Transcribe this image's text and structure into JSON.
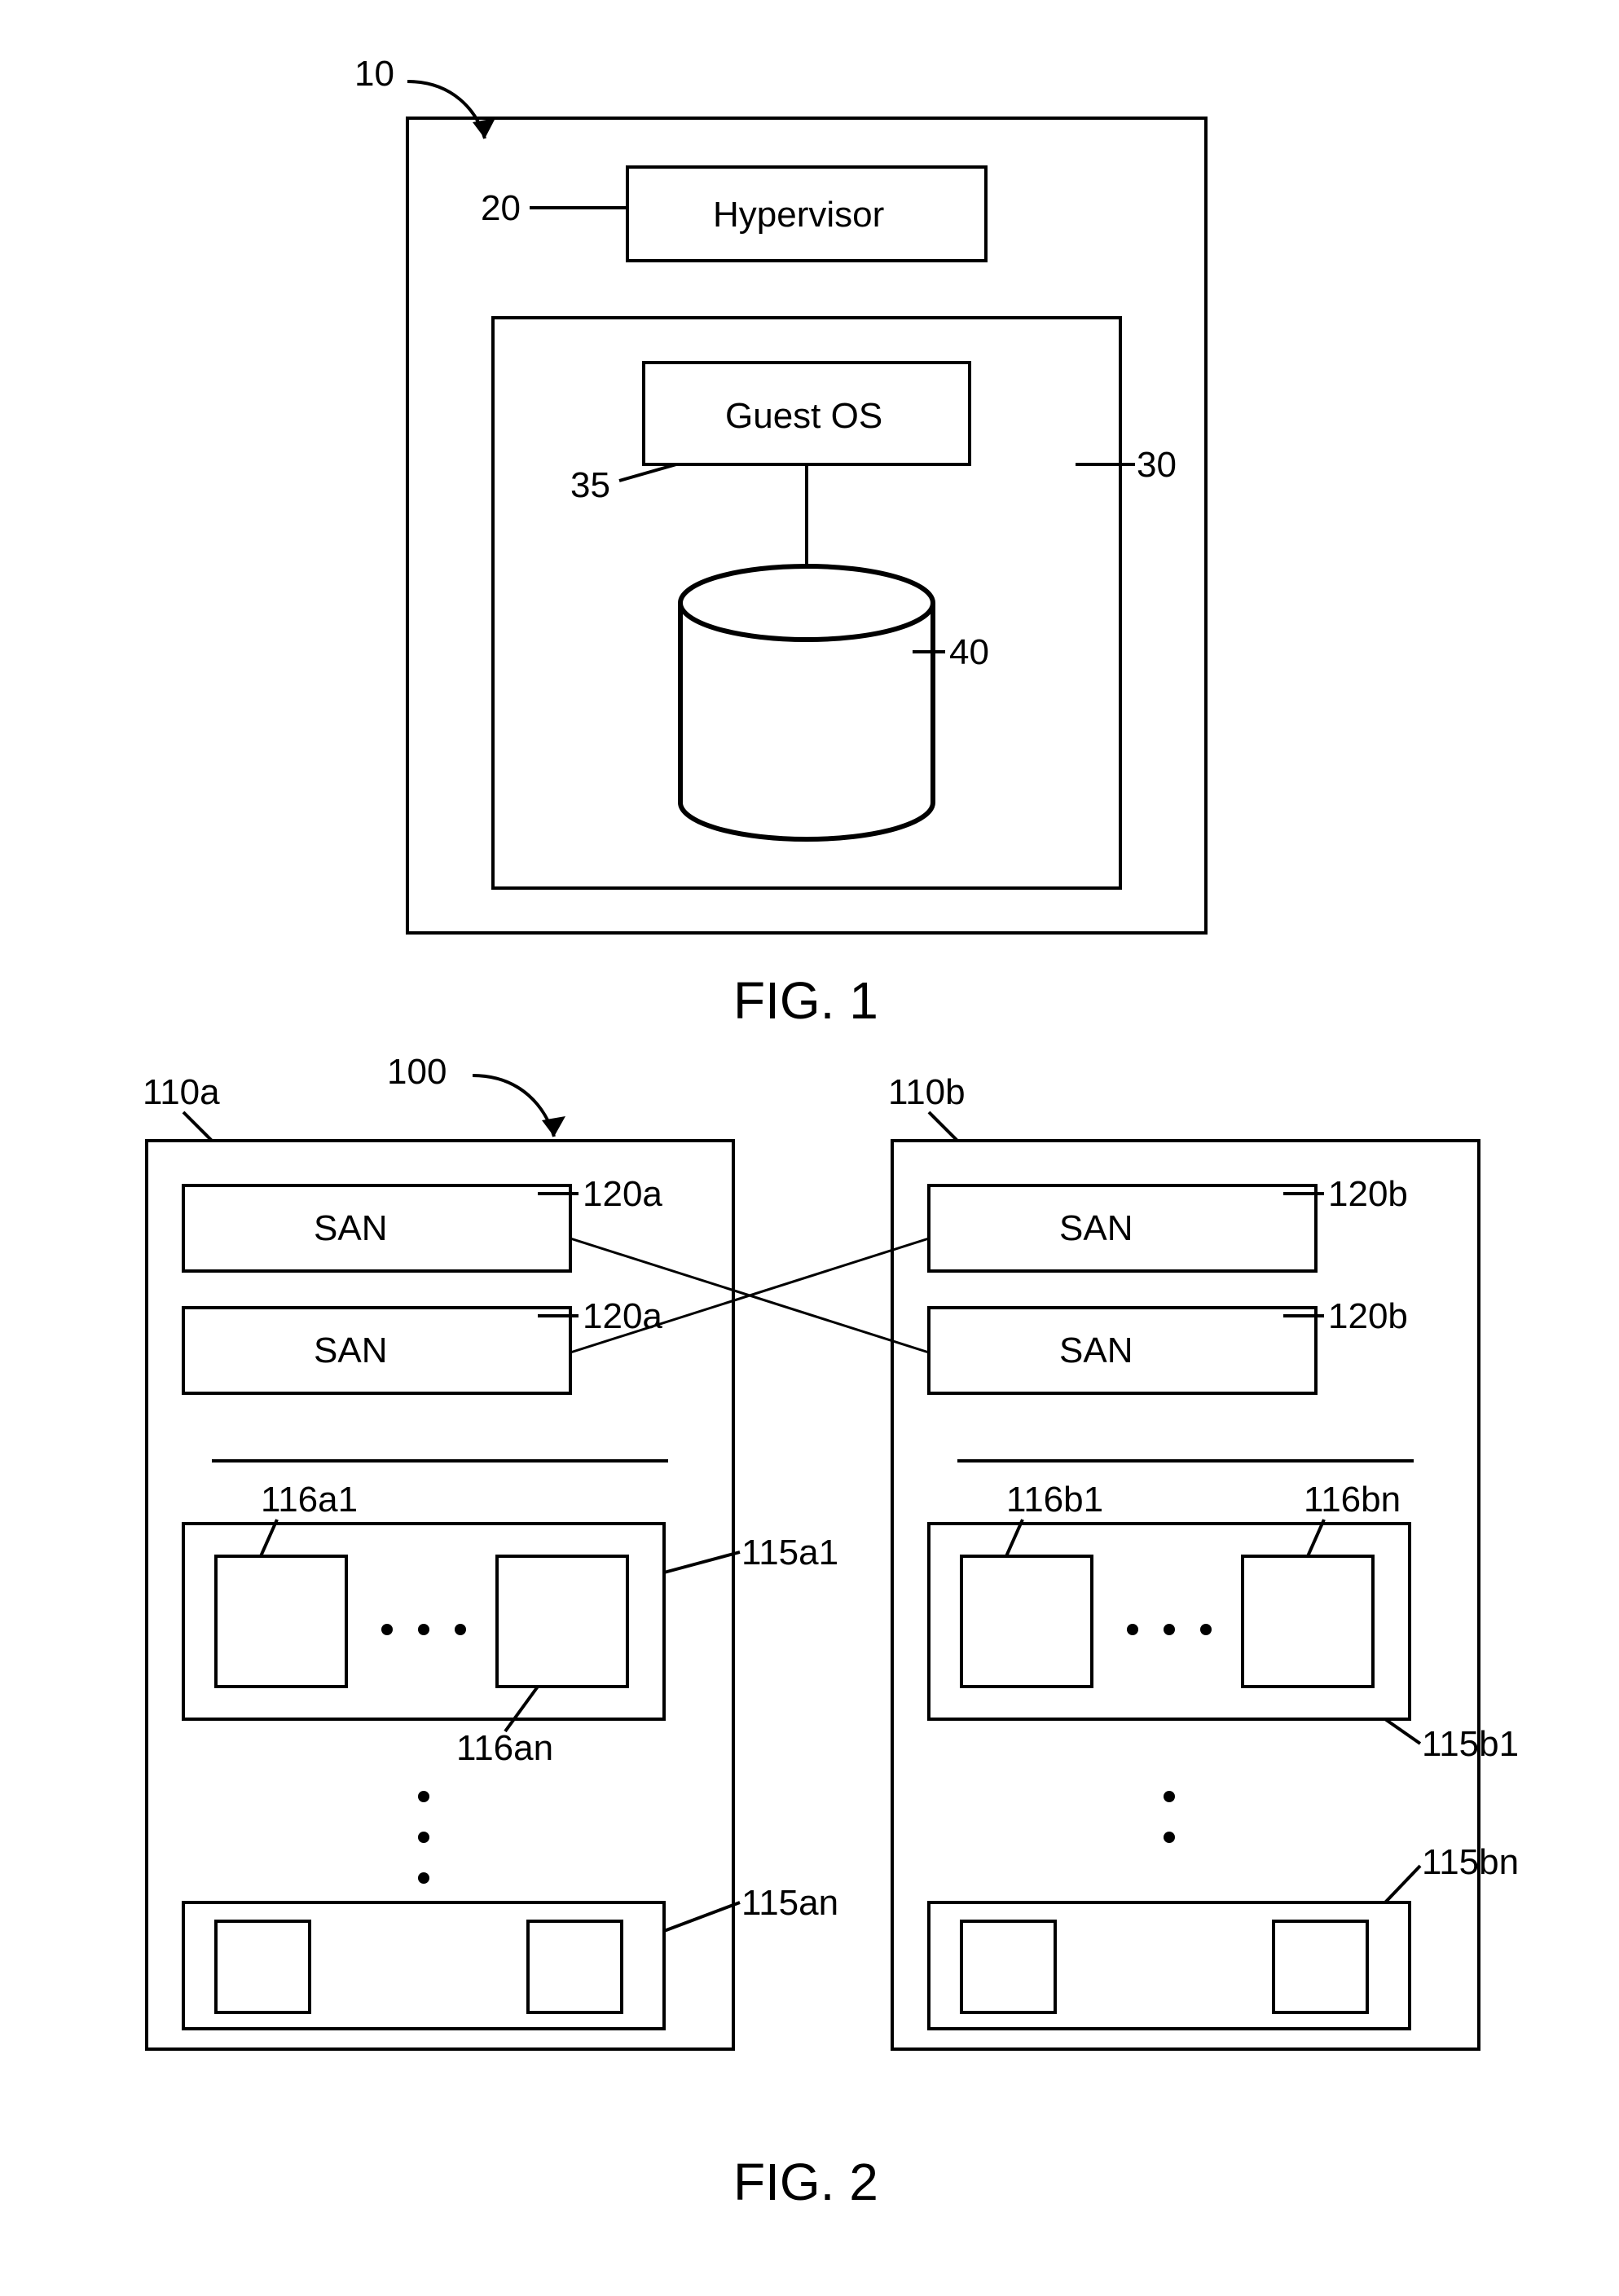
{
  "fig1": {
    "caption": "FIG. 1",
    "ref_host": "10",
    "ref_hypervisor": "20",
    "ref_vm": "30",
    "ref_guest_os": "35",
    "ref_disk": "40",
    "label_hypervisor": "Hypervisor",
    "label_guest_os": "Guest OS"
  },
  "fig2": {
    "caption": "FIG. 2",
    "ref_system": "100",
    "left": {
      "ref_rack": "110a",
      "san_top_label": "SAN",
      "san_top_ref": "120a",
      "san_bottom_label": "SAN",
      "san_bottom_ref": "120a",
      "ref_server_top": "115a1",
      "ref_server_bottom": "115an",
      "ref_node_left": "116a1",
      "ref_node_right": "116an"
    },
    "right": {
      "ref_rack": "110b",
      "san_top_label": "SAN",
      "san_top_ref": "120b",
      "san_bottom_label": "SAN",
      "san_bottom_ref": "120b",
      "ref_server_top": "115b1",
      "ref_server_bottom": "115bn",
      "ref_node_left": "116b1",
      "ref_node_right": "116bn"
    }
  }
}
